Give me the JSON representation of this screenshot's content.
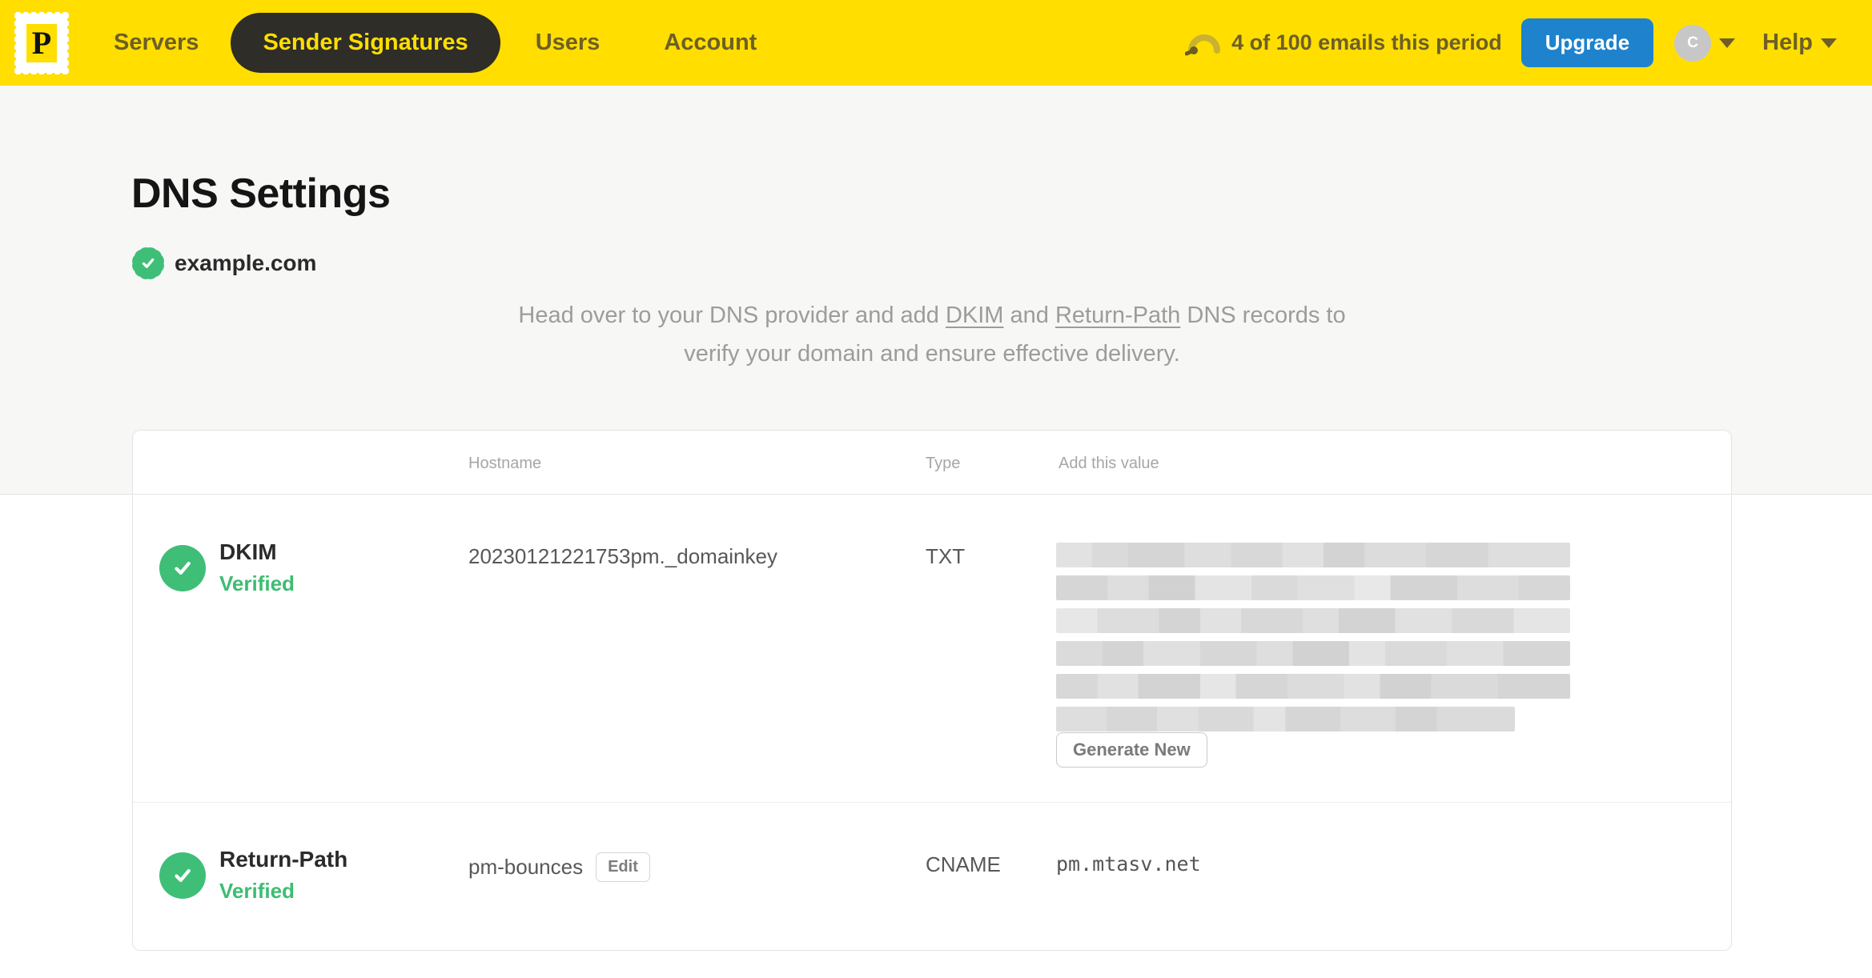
{
  "nav": {
    "logo_letter": "P",
    "items": [
      {
        "label": "Servers",
        "active": false
      },
      {
        "label": "Sender Signatures",
        "active": true
      },
      {
        "label": "Users",
        "active": false
      },
      {
        "label": "Account",
        "active": false
      }
    ],
    "usage_text": "4 of 100 emails this period",
    "upgrade_label": "Upgrade",
    "avatar_initial": "C",
    "help_label": "Help"
  },
  "page": {
    "title": "DNS Settings",
    "domain": "example.com",
    "description": {
      "line1_pre": "Head over to your DNS provider and add ",
      "link_dkim": "DKIM",
      "line1_mid": " and ",
      "link_return_path": "Return-Path",
      "line1_post": " DNS records to",
      "line2": "verify your domain and ensure effective delivery."
    }
  },
  "table": {
    "headers": {
      "hostname": "Hostname",
      "type": "Type",
      "value": "Add this value"
    },
    "rows": [
      {
        "name": "DKIM",
        "status": "Verified",
        "hostname": "20230121221753pm._domainkey",
        "type": "TXT",
        "value_redacted": true,
        "action_label": "Generate New"
      },
      {
        "name": "Return-Path",
        "status": "Verified",
        "hostname": "pm-bounces",
        "edit_label": "Edit",
        "type": "CNAME",
        "value": "pm.mtasv.net"
      }
    ]
  },
  "colors": {
    "brand_yellow": "#FFDE00",
    "nav_text_olive": "#6D5F27",
    "active_pill_dark": "#2E2D28",
    "upgrade_blue": "#1E82CD",
    "success_green": "#3FBE78",
    "verified_text_green": "#3DBD72"
  }
}
